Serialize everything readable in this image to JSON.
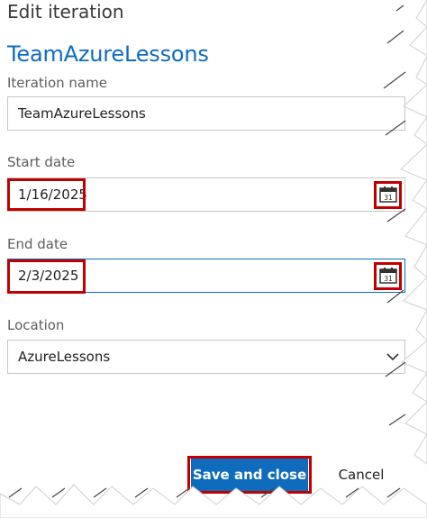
{
  "dialog": {
    "title": "Edit iteration",
    "subtitle": "TeamAzureLessons"
  },
  "fields": {
    "iteration_name": {
      "label": "Iteration name",
      "value": "TeamAzureLessons"
    },
    "start_date": {
      "label": "Start date",
      "value": "1/16/2025",
      "icon": "calendar-icon",
      "icon_text": "31"
    },
    "end_date": {
      "label": "End date",
      "value": "2/3/2025",
      "icon": "calendar-icon",
      "icon_text": "31"
    },
    "location": {
      "label": "Location",
      "value": "AzureLessons",
      "icon": "chevron-down-icon"
    }
  },
  "actions": {
    "save_label": "Save and close",
    "cancel_label": "Cancel"
  },
  "colors": {
    "accent": "#0f6cbd",
    "highlight": "#c00000"
  }
}
